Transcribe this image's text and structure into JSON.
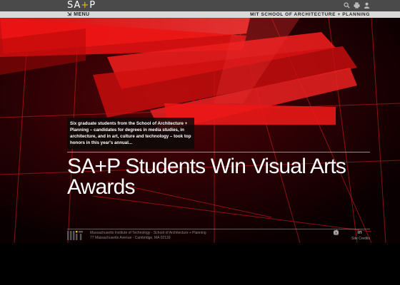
{
  "header": {
    "logo_prefix": "SA",
    "logo_plus": "+",
    "logo_suffix": "P",
    "icons": [
      "search-icon",
      "print-icon",
      "user-icon"
    ]
  },
  "menubar": {
    "menu_label": "MENU",
    "menu_icon": "chevron-down-icon",
    "site_name": "MIT SCHOOL OF ARCHITECTURE + PLANNING"
  },
  "hero": {
    "excerpt": "Six graduate students from the School of Architecture + Planning – candidates for degrees in media studies, in architecture, and in art, culture and technology – took top honors in this year's annual...",
    "headline": "SA+P Students Win Visual Arts Awards"
  },
  "footer": {
    "line1": "Massachusetts Institute of Technology · School of Architecture + Planning",
    "line2": "77 Massachusetts Avenue · Cambridge, MA 02139",
    "social_icons": [
      "facebook-icon",
      "twitter-icon",
      "youtube-icon",
      "linkedin-icon",
      "instagram-icon"
    ],
    "credits": "Site Credits"
  },
  "colors": {
    "accent": "#f3b51f",
    "topbar": "#4a4a4a",
    "menubar": "#d9d9d9",
    "hero_red": "#ff1a1a"
  }
}
